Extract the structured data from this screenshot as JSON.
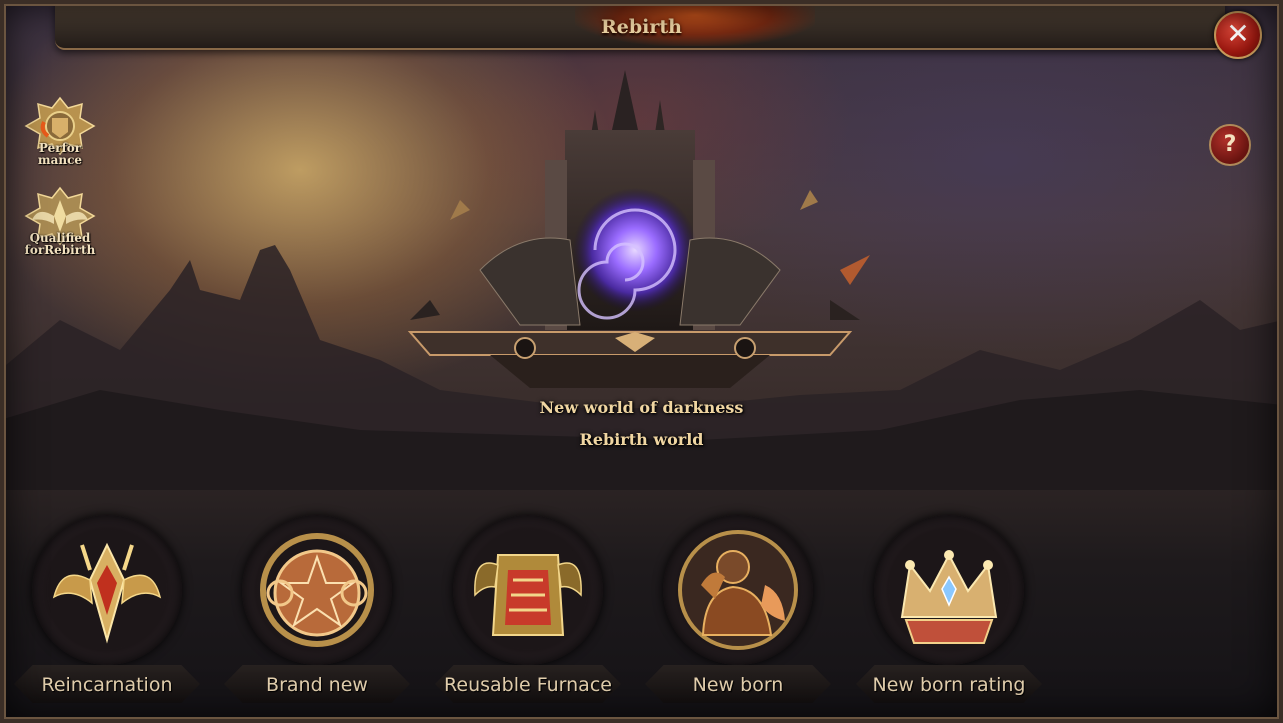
{
  "window": {
    "title": "Rebirth"
  },
  "controls": {
    "close_glyph": "✕",
    "help_glyph": "?"
  },
  "side_icons": [
    {
      "label_line1": "Perfor",
      "label_line2": "mance",
      "icon": "trophy-icon"
    },
    {
      "label_line1": "Qualified",
      "label_line2": "forRebirth",
      "icon": "winged-crest-icon"
    }
  ],
  "world": {
    "subtitle": "New world of darkness",
    "name": "Rebirth world"
  },
  "features": [
    {
      "label": "Reincarnation",
      "icon": "winged-helmet-icon"
    },
    {
      "label": "Brand new",
      "icon": "magic-circle-icon"
    },
    {
      "label": "Reusable Furnace",
      "icon": "armor-furnace-icon"
    },
    {
      "label": "New born",
      "icon": "warrior-portrait-icon"
    },
    {
      "label": "New born rating",
      "icon": "crown-icon"
    }
  ],
  "colors": {
    "accent_gold": "#f0d6a2",
    "close_red": "#c0281c",
    "portal_purple": "#8a5cff"
  }
}
